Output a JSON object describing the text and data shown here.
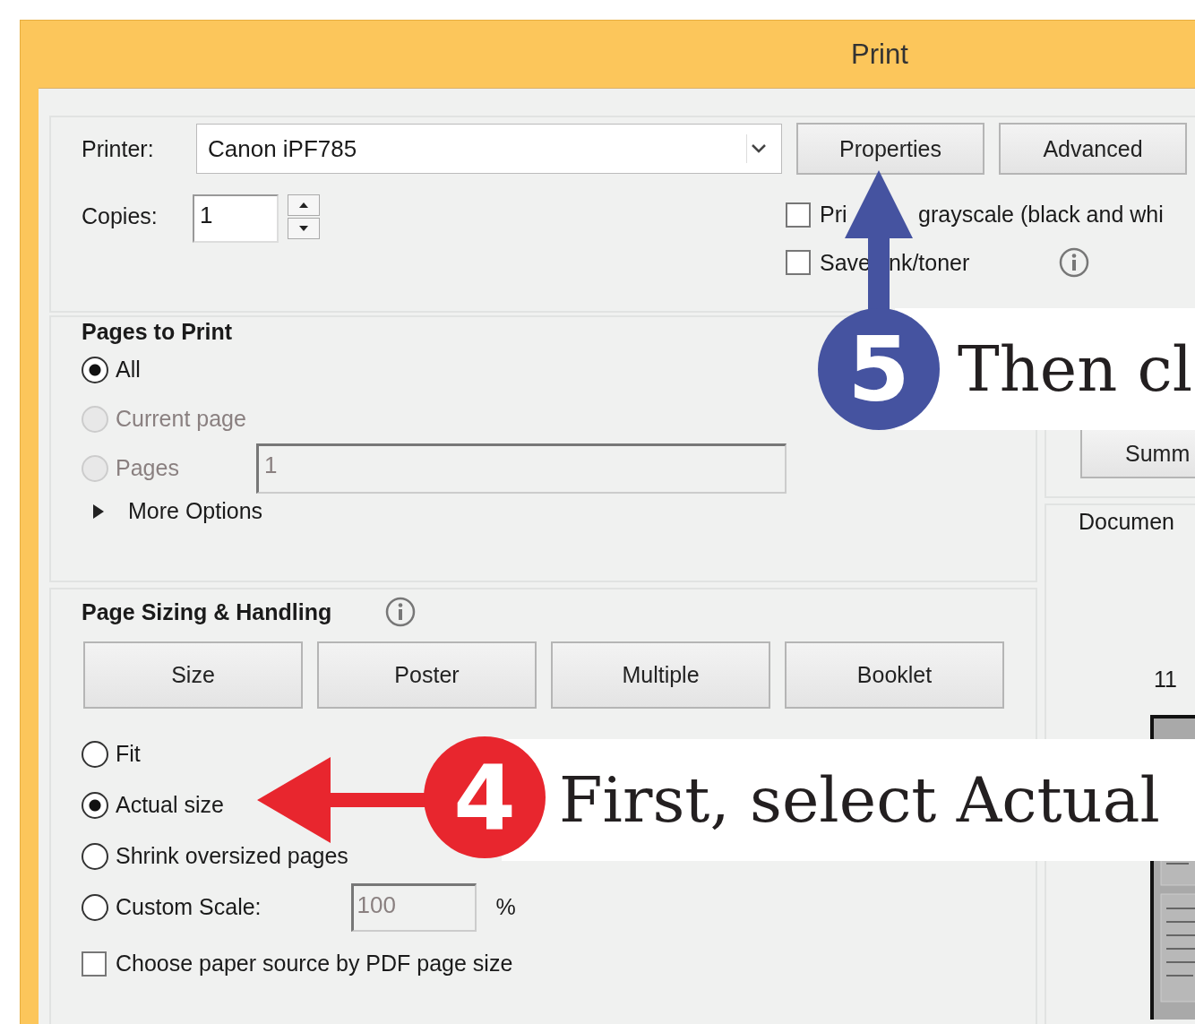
{
  "window": {
    "title": "Print"
  },
  "printer": {
    "label": "Printer:",
    "value": "Canon iPF785"
  },
  "buttons": [
    {
      "label": "Properties"
    },
    {
      "label": "Advanced"
    }
  ],
  "copies": {
    "label": "Copies:",
    "value": "1"
  },
  "options": [
    {
      "label_parts": [
        "Pri",
        "grayscale (black and whi"
      ],
      "checked": false
    },
    {
      "label_parts": [
        "Save",
        "nk/toner"
      ],
      "checked": false,
      "info": true
    }
  ],
  "pages_to_print": {
    "title": "Pages to Print",
    "choices": [
      {
        "label": "All",
        "selected": true,
        "disabled": false
      },
      {
        "label": "Current page",
        "selected": false,
        "disabled": true
      },
      {
        "label": "Pages",
        "selected": false,
        "disabled": true,
        "value": "1"
      }
    ],
    "more_options": "More Options"
  },
  "page_sizing": {
    "title": "Page Sizing & Handling",
    "modes": [
      "Size",
      "Poster",
      "Multiple",
      "Booklet"
    ],
    "scaling": [
      {
        "label": "Fit",
        "selected": false
      },
      {
        "label": "Actual size",
        "selected": true
      },
      {
        "label": "Shrink oversized pages",
        "selected": false
      },
      {
        "label": "Custom Scale:",
        "selected": false,
        "value": "100",
        "unit": "%"
      }
    ],
    "paper_source": {
      "label": "Choose paper source by PDF page size",
      "checked": false
    }
  },
  "side": {
    "summary_button": "Summ",
    "document_label": "Documen",
    "page_size": "11"
  },
  "callouts": [
    {
      "number": "5",
      "text": "Then cl",
      "color": "#4553a0",
      "kind": "up"
    },
    {
      "number": "4",
      "text": "First, select Actual",
      "color": "#e8262e",
      "kind": "left"
    }
  ]
}
